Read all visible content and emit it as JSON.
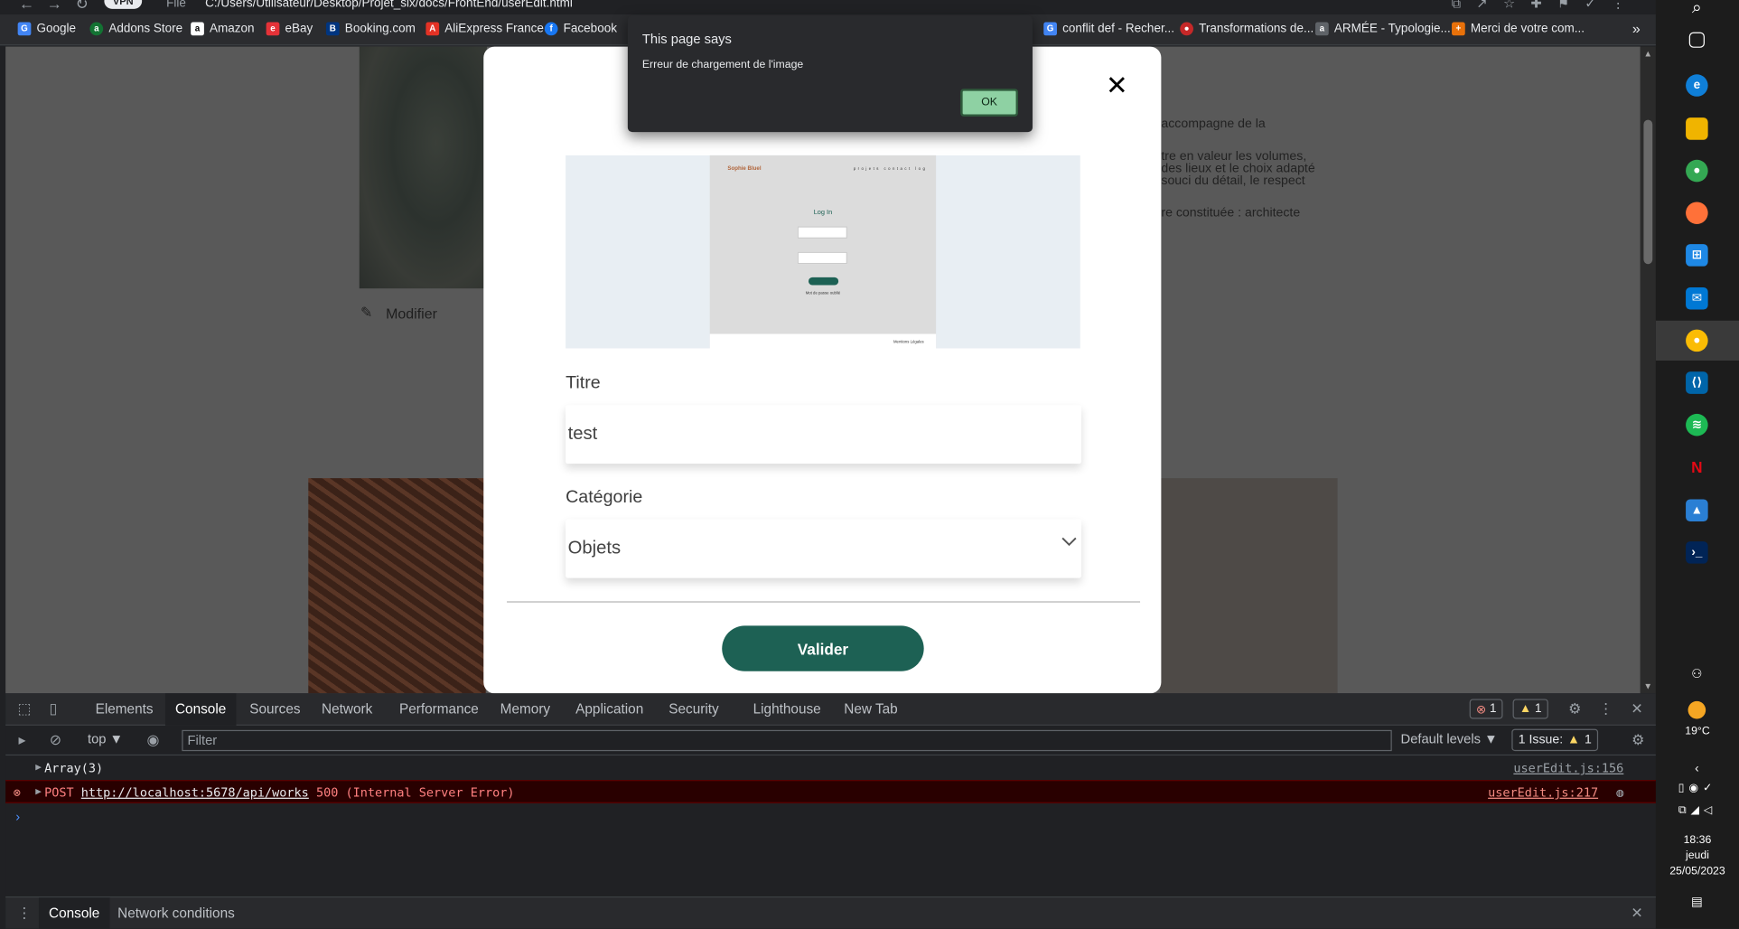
{
  "browser": {
    "vpn_label": "VPN",
    "scheme": "File",
    "url": "C:/Users/Utilisateur/Desktop/Projet_six/docs/FrontEnd/userEdit.html",
    "bookmarks": [
      {
        "label": "Google",
        "icon": "google-icon",
        "color": "#4285f4"
      },
      {
        "label": "Addons Store",
        "icon": "addons-store-icon",
        "color": "#137333"
      },
      {
        "label": "Amazon",
        "icon": "amazon-icon",
        "color": "#ff9900"
      },
      {
        "label": "eBay",
        "icon": "ebay-icon",
        "color": "#e53238"
      },
      {
        "label": "Booking.com",
        "icon": "booking-icon",
        "color": "#003580"
      },
      {
        "label": "AliExpress France",
        "icon": "aliexpress-icon",
        "color": "#e43225"
      },
      {
        "label": "Facebook",
        "icon": "facebook-icon",
        "color": "#1877f2"
      },
      {
        "label": "conflit def - Recher...",
        "icon": "google-icon",
        "color": "#4285f4"
      },
      {
        "label": "Transformations de...",
        "icon": "transformations-icon",
        "color": "#c62828"
      },
      {
        "label": "ARMÉE - Typologie...",
        "icon": "armee-icon",
        "color": "#5f6368"
      },
      {
        "label": "Merci de votre com...",
        "icon": "merci-icon",
        "color": "#e8710a"
      }
    ]
  },
  "page_background": {
    "edit_label": "Modifier",
    "text_fragments": [
      "accompagne de la",
      "tre en valeur les volumes,",
      "des lieux et le choix adapté",
      "souci du détail, le respect",
      "re constituée : architecte"
    ]
  },
  "modal": {
    "preview": {
      "logo": "Sophie Bluel",
      "menu": "projets contact log",
      "heading": "Log In",
      "forgot": "Mot de passe oublié",
      "footer": "Mentions Légales"
    },
    "title_label": "Titre",
    "title_value": "test",
    "category_label": "Catégorie",
    "category_value": "Objets",
    "submit_label": "Valider"
  },
  "alert": {
    "heading": "This page says",
    "message": "Erreur de chargement de l'image",
    "ok_label": "OK"
  },
  "devtools": {
    "tabs": [
      "Elements",
      "Console",
      "Sources",
      "Network",
      "Performance",
      "Memory",
      "Application",
      "Security",
      "Lighthouse",
      "New Tab"
    ],
    "active_tab": "Console",
    "error_count": "1",
    "warning_count": "1",
    "context": "top ▼",
    "filter_placeholder": "Filter",
    "levels": "Default levels ▼",
    "issues_label": "1 Issue:",
    "issues_count": "1",
    "logs": [
      {
        "text": "Array(3)",
        "source": "userEdit.js:156",
        "type": "log"
      },
      {
        "method": "POST",
        "url": "http://localhost:5678/api/works",
        "status": "500 (Internal Server Error)",
        "source": "userEdit.js:217",
        "type": "error"
      }
    ],
    "drawer_tabs": [
      "Console",
      "Network conditions"
    ]
  },
  "taskbar": {
    "weather": "19°C",
    "time": "18:36",
    "day": "jeudi",
    "date": "25/05/2023"
  },
  "colors": {
    "accent": "#1d6154",
    "error_bg": "#290000",
    "error_text": "#ff8080"
  }
}
